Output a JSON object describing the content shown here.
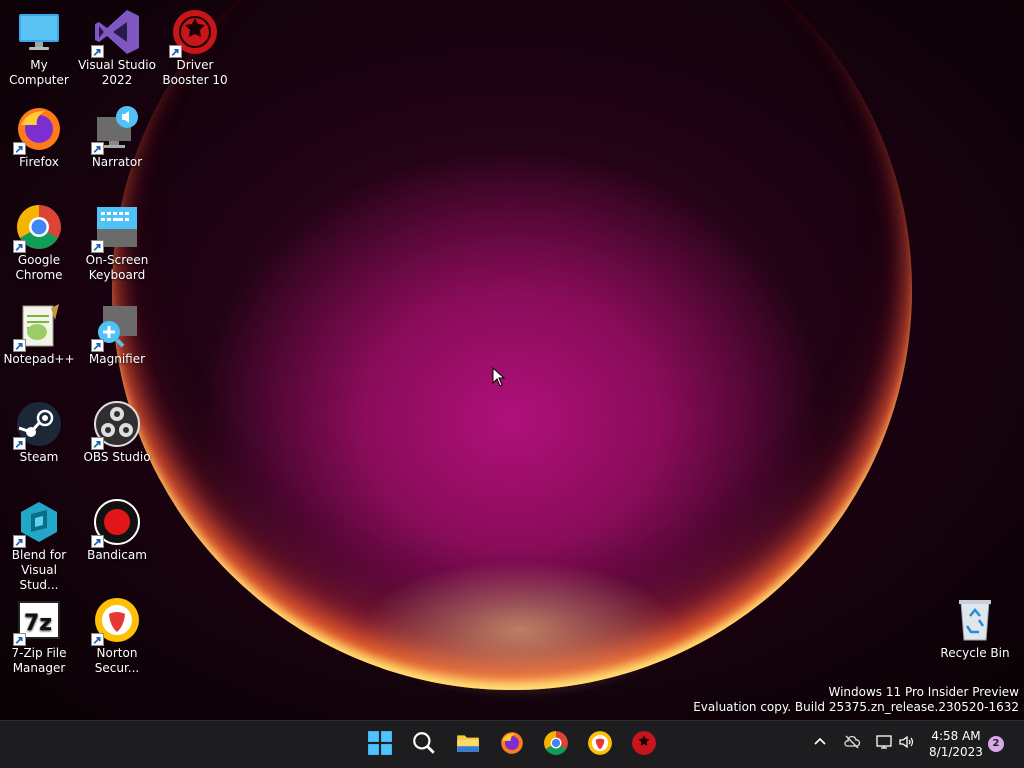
{
  "desktop": {
    "icons": [
      {
        "label": "My Computer",
        "icon": "monitor-icon"
      },
      {
        "label": "Visual Studio 2022",
        "icon": "visual-studio-icon"
      },
      {
        "label": "Driver Booster 10",
        "icon": "driver-booster-icon"
      },
      {
        "label": "Firefox",
        "icon": "firefox-icon"
      },
      {
        "label": "Narrator",
        "icon": "narrator-icon"
      },
      {
        "label": "Google Chrome",
        "icon": "chrome-icon"
      },
      {
        "label": "On-Screen Keyboard",
        "icon": "keyboard-icon"
      },
      {
        "label": "Notepad++",
        "icon": "notepadpp-icon"
      },
      {
        "label": "Magnifier",
        "icon": "magnifier-icon"
      },
      {
        "label": "Steam",
        "icon": "steam-icon"
      },
      {
        "label": "OBS Studio",
        "icon": "obs-icon"
      },
      {
        "label": "Blend for Visual Stud...",
        "icon": "blend-icon"
      },
      {
        "label": "Bandicam",
        "icon": "bandicam-icon"
      },
      {
        "label": "7-Zip File Manager",
        "icon": "7zip-icon"
      },
      {
        "label": "Norton Secur...",
        "icon": "norton-icon"
      },
      {
        "label": "Recycle Bin",
        "icon": "recycle-bin-icon"
      }
    ]
  },
  "watermark": {
    "line1": "Windows 11 Pro Insider Preview",
    "line2": "Evaluation copy. Build 25375.zn_release.230520-1632"
  },
  "taskbar": {
    "pinned": [
      "start-icon",
      "search-icon",
      "file-explorer-icon",
      "firefox-icon",
      "chrome-icon",
      "norton-icon",
      "driver-booster-icon"
    ],
    "clock_time": "4:58 AM",
    "clock_date": "8/1/2023",
    "notification_count": "2"
  },
  "colors": {
    "accent": "#0a84ff",
    "taskbar": "#1d1d1f"
  }
}
